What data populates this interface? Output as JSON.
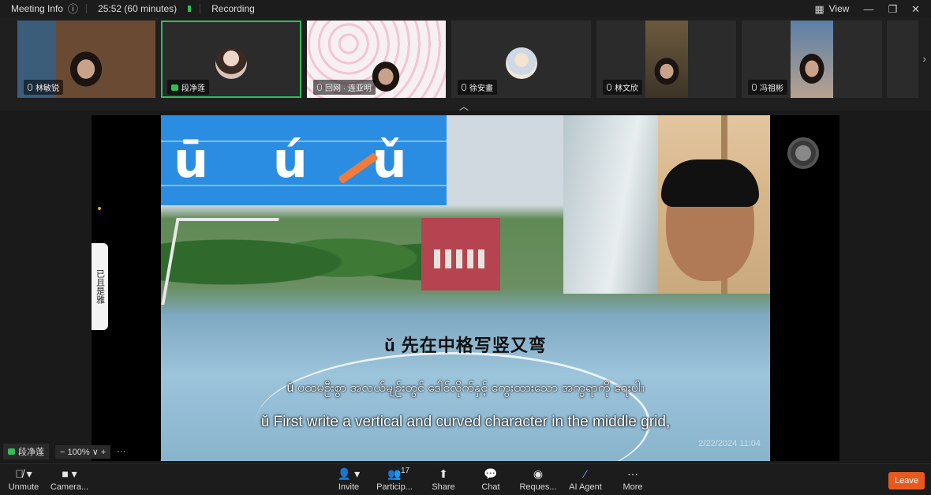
{
  "topbar": {
    "meeting_info": "Meeting Info",
    "timer": "25:52 (60 minutes)",
    "recording": "Recording",
    "view": "View"
  },
  "participants": [
    {
      "name": "林敏锐"
    },
    {
      "name": "段净莲"
    },
    {
      "name": "回网 · 连亚明"
    },
    {
      "name": "徐安畫"
    },
    {
      "name": "林文欣"
    },
    {
      "name": "冯祖彬"
    }
  ],
  "share": {
    "pinyin": "ū ú ǔ",
    "caption_cn": "ǔ 先在中格写竖又弯",
    "caption_my": "ǔ ပထမဦးစွာ အလယ်မျဉ်းတွင် ဒေါင်လိုက်နှင့် ကွေးထားသော အက္ခရာကို ရေးပါ။",
    "caption_en": "ǔ First write a vertical and curved character in the middle grid,",
    "stamp": "2/22/2024 11:04",
    "side_tab": "已且是雅"
  },
  "mini_bar": {
    "name": "段净莲",
    "zoom": "100%"
  },
  "toolbar": {
    "unmute": "Unmute",
    "camera": "Camera...",
    "invite": "Invite",
    "participants": "Particip...",
    "participants_count": "17",
    "share": "Share",
    "chat": "Chat",
    "requests": "Reques...",
    "ai_agent": "AI Agent",
    "more": "More",
    "leave": "Leave"
  },
  "colors": {
    "accent_green": "#2fbf5a",
    "leave_orange": "#e8591e",
    "slide_blue": "#2b8de2"
  }
}
